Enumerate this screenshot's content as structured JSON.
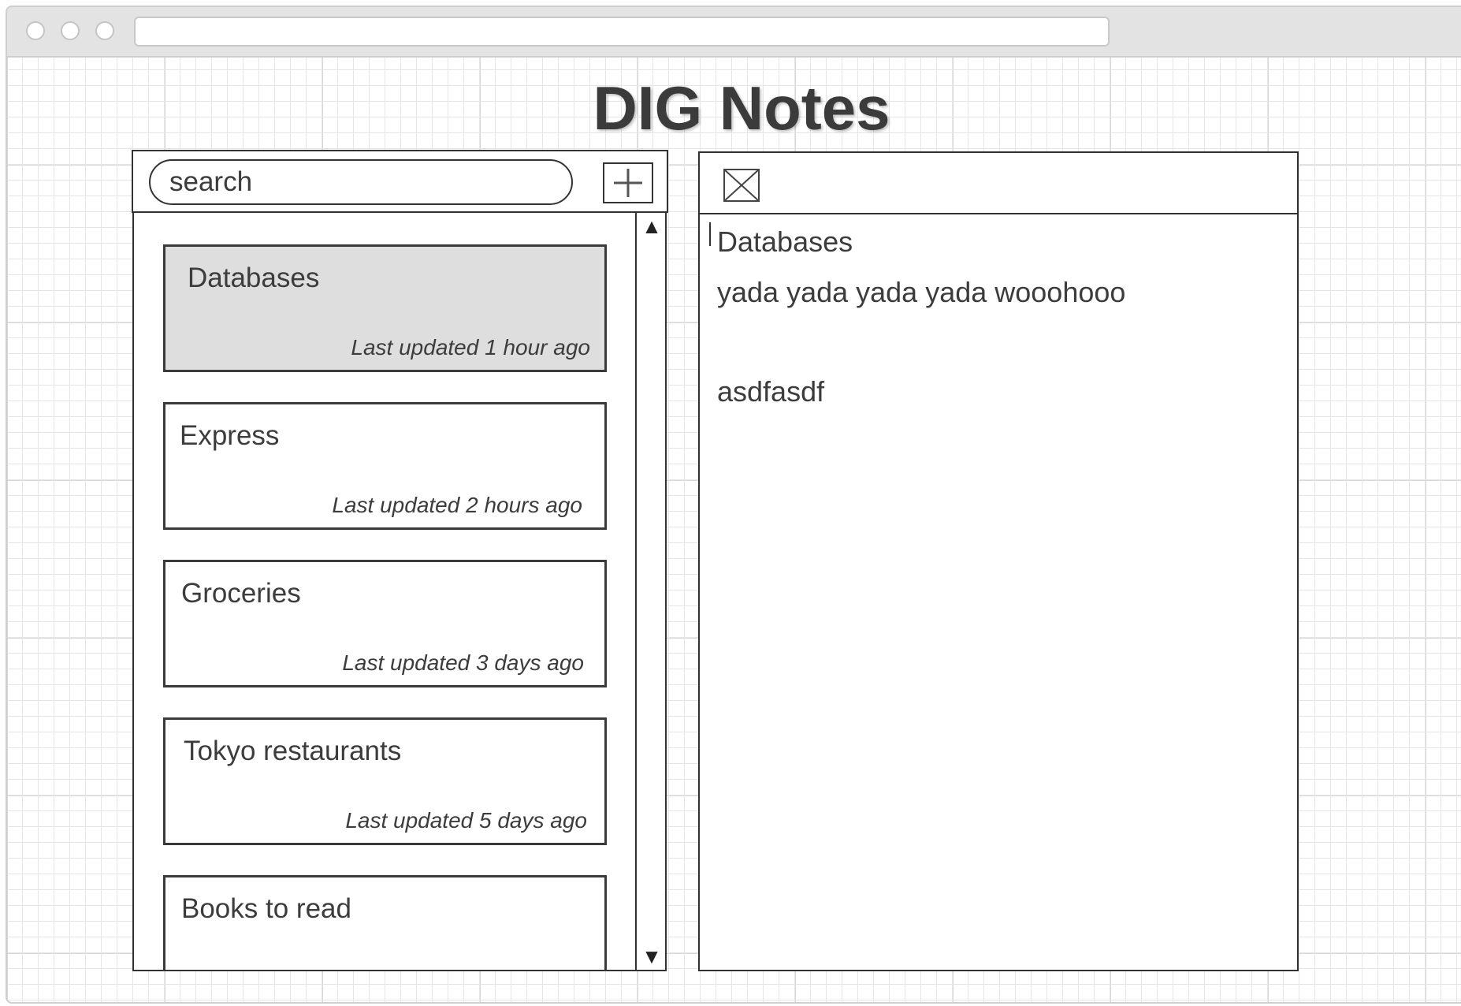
{
  "app": {
    "title": "DIG Notes"
  },
  "browser": {
    "address_value": ""
  },
  "search": {
    "placeholder": "search"
  },
  "notes": [
    {
      "title": "Databases",
      "updated": "Last updated 1 hour ago",
      "selected": true
    },
    {
      "title": "Express",
      "updated": "Last updated 2 hours ago",
      "selected": false
    },
    {
      "title": "Groceries",
      "updated": "Last updated 3 days ago",
      "selected": false
    },
    {
      "title": "Tokyo restaurants",
      "updated": "Last updated 5 days ago",
      "selected": false
    },
    {
      "title": "Books to read",
      "updated": "",
      "selected": false
    }
  ],
  "editor": {
    "lines": [
      "Databases",
      "yada yada yada yada wooohooo",
      "asdfasdf"
    ]
  },
  "icons": {
    "add": "plus-icon",
    "close": "close-box-icon",
    "scroll_up": "triangle-up-icon",
    "scroll_down": "triangle-down-icon"
  },
  "colors": {
    "selected_card": "#dedede",
    "border": "#333333",
    "text": "#3c3c3c"
  }
}
